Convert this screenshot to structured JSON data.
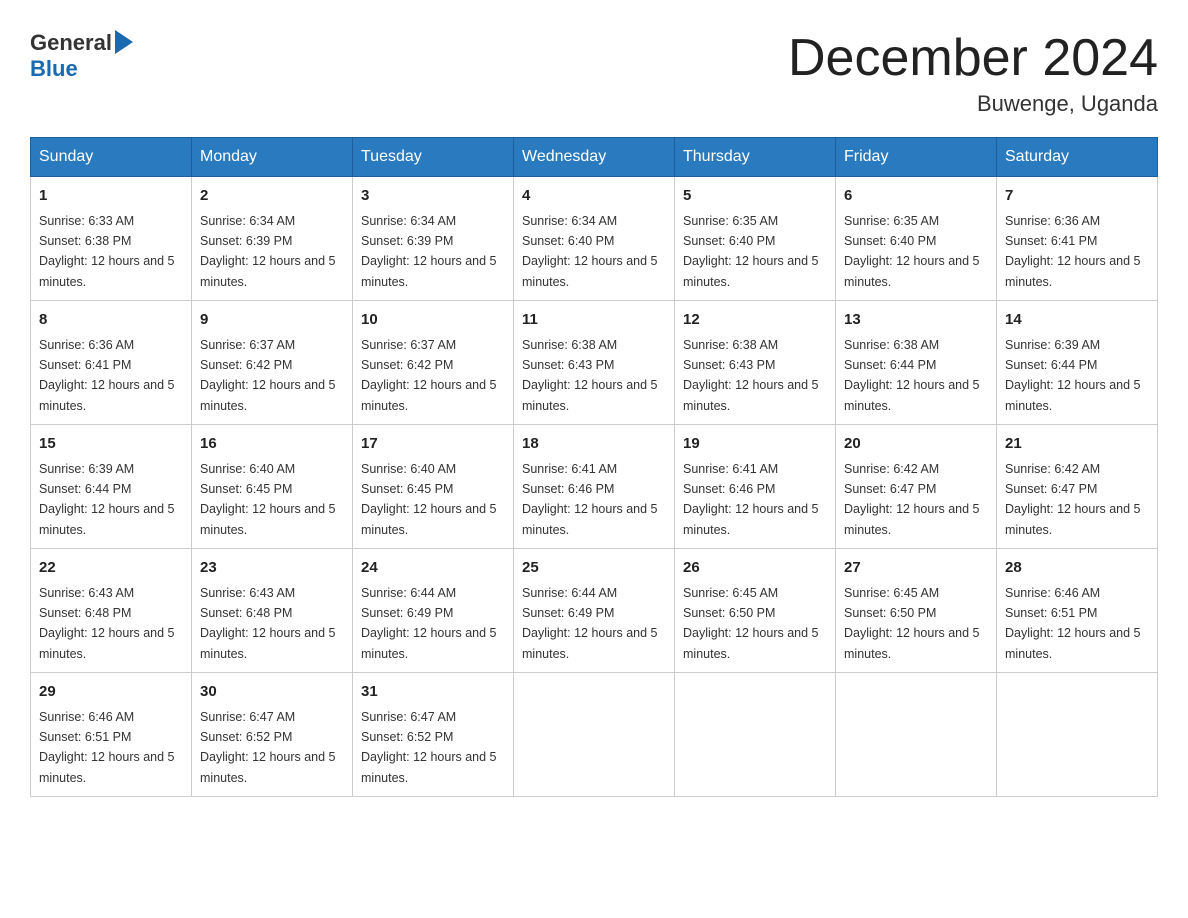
{
  "header": {
    "logo_general": "General",
    "logo_blue": "Blue",
    "month_title": "December 2024",
    "location": "Buwenge, Uganda"
  },
  "weekdays": [
    "Sunday",
    "Monday",
    "Tuesday",
    "Wednesday",
    "Thursday",
    "Friday",
    "Saturday"
  ],
  "weeks": [
    [
      {
        "day": "1",
        "sunrise": "6:33 AM",
        "sunset": "6:38 PM",
        "daylight": "12 hours and 5 minutes."
      },
      {
        "day": "2",
        "sunrise": "6:34 AM",
        "sunset": "6:39 PM",
        "daylight": "12 hours and 5 minutes."
      },
      {
        "day": "3",
        "sunrise": "6:34 AM",
        "sunset": "6:39 PM",
        "daylight": "12 hours and 5 minutes."
      },
      {
        "day": "4",
        "sunrise": "6:34 AM",
        "sunset": "6:40 PM",
        "daylight": "12 hours and 5 minutes."
      },
      {
        "day": "5",
        "sunrise": "6:35 AM",
        "sunset": "6:40 PM",
        "daylight": "12 hours and 5 minutes."
      },
      {
        "day": "6",
        "sunrise": "6:35 AM",
        "sunset": "6:40 PM",
        "daylight": "12 hours and 5 minutes."
      },
      {
        "day": "7",
        "sunrise": "6:36 AM",
        "sunset": "6:41 PM",
        "daylight": "12 hours and 5 minutes."
      }
    ],
    [
      {
        "day": "8",
        "sunrise": "6:36 AM",
        "sunset": "6:41 PM",
        "daylight": "12 hours and 5 minutes."
      },
      {
        "day": "9",
        "sunrise": "6:37 AM",
        "sunset": "6:42 PM",
        "daylight": "12 hours and 5 minutes."
      },
      {
        "day": "10",
        "sunrise": "6:37 AM",
        "sunset": "6:42 PM",
        "daylight": "12 hours and 5 minutes."
      },
      {
        "day": "11",
        "sunrise": "6:38 AM",
        "sunset": "6:43 PM",
        "daylight": "12 hours and 5 minutes."
      },
      {
        "day": "12",
        "sunrise": "6:38 AM",
        "sunset": "6:43 PM",
        "daylight": "12 hours and 5 minutes."
      },
      {
        "day": "13",
        "sunrise": "6:38 AM",
        "sunset": "6:44 PM",
        "daylight": "12 hours and 5 minutes."
      },
      {
        "day": "14",
        "sunrise": "6:39 AM",
        "sunset": "6:44 PM",
        "daylight": "12 hours and 5 minutes."
      }
    ],
    [
      {
        "day": "15",
        "sunrise": "6:39 AM",
        "sunset": "6:44 PM",
        "daylight": "12 hours and 5 minutes."
      },
      {
        "day": "16",
        "sunrise": "6:40 AM",
        "sunset": "6:45 PM",
        "daylight": "12 hours and 5 minutes."
      },
      {
        "day": "17",
        "sunrise": "6:40 AM",
        "sunset": "6:45 PM",
        "daylight": "12 hours and 5 minutes."
      },
      {
        "day": "18",
        "sunrise": "6:41 AM",
        "sunset": "6:46 PM",
        "daylight": "12 hours and 5 minutes."
      },
      {
        "day": "19",
        "sunrise": "6:41 AM",
        "sunset": "6:46 PM",
        "daylight": "12 hours and 5 minutes."
      },
      {
        "day": "20",
        "sunrise": "6:42 AM",
        "sunset": "6:47 PM",
        "daylight": "12 hours and 5 minutes."
      },
      {
        "day": "21",
        "sunrise": "6:42 AM",
        "sunset": "6:47 PM",
        "daylight": "12 hours and 5 minutes."
      }
    ],
    [
      {
        "day": "22",
        "sunrise": "6:43 AM",
        "sunset": "6:48 PM",
        "daylight": "12 hours and 5 minutes."
      },
      {
        "day": "23",
        "sunrise": "6:43 AM",
        "sunset": "6:48 PM",
        "daylight": "12 hours and 5 minutes."
      },
      {
        "day": "24",
        "sunrise": "6:44 AM",
        "sunset": "6:49 PM",
        "daylight": "12 hours and 5 minutes."
      },
      {
        "day": "25",
        "sunrise": "6:44 AM",
        "sunset": "6:49 PM",
        "daylight": "12 hours and 5 minutes."
      },
      {
        "day": "26",
        "sunrise": "6:45 AM",
        "sunset": "6:50 PM",
        "daylight": "12 hours and 5 minutes."
      },
      {
        "day": "27",
        "sunrise": "6:45 AM",
        "sunset": "6:50 PM",
        "daylight": "12 hours and 5 minutes."
      },
      {
        "day": "28",
        "sunrise": "6:46 AM",
        "sunset": "6:51 PM",
        "daylight": "12 hours and 5 minutes."
      }
    ],
    [
      {
        "day": "29",
        "sunrise": "6:46 AM",
        "sunset": "6:51 PM",
        "daylight": "12 hours and 5 minutes."
      },
      {
        "day": "30",
        "sunrise": "6:47 AM",
        "sunset": "6:52 PM",
        "daylight": "12 hours and 5 minutes."
      },
      {
        "day": "31",
        "sunrise": "6:47 AM",
        "sunset": "6:52 PM",
        "daylight": "12 hours and 5 minutes."
      },
      null,
      null,
      null,
      null
    ]
  ]
}
